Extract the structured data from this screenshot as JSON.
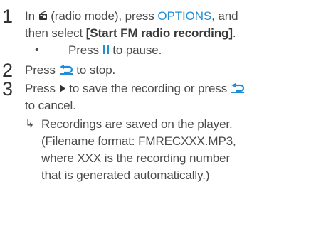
{
  "step1": {
    "number": "1",
    "line1_a": "In",
    "line1_b": "(radio mode), press",
    "line1_options": "OPTIONS",
    "line1_c": ", and",
    "line2_a": "then select",
    "line2_bold": "[Start FM radio recording]",
    "line2_c": ".",
    "bullet": "•",
    "sub_a": "Press",
    "sub_b": "to pause."
  },
  "step2": {
    "number": "2",
    "text_a": "Press",
    "text_b": "to stop."
  },
  "step3": {
    "number": "3",
    "line1_a": "Press",
    "line1_b": "to save the recording or press",
    "line2": "to cancel.",
    "result_arrow": "↳",
    "result_lines": [
      "Recordings are saved on the player.",
      "(Filename format: FMRECXXX.MP3,",
      "where XXX is the recording number",
      "that is generated automatically.)"
    ]
  },
  "colors": {
    "accent": "#1f8ed6",
    "text": "#4a4a4a"
  },
  "icons": [
    "radio-icon",
    "pause-icon",
    "back-icon",
    "play-icon"
  ]
}
